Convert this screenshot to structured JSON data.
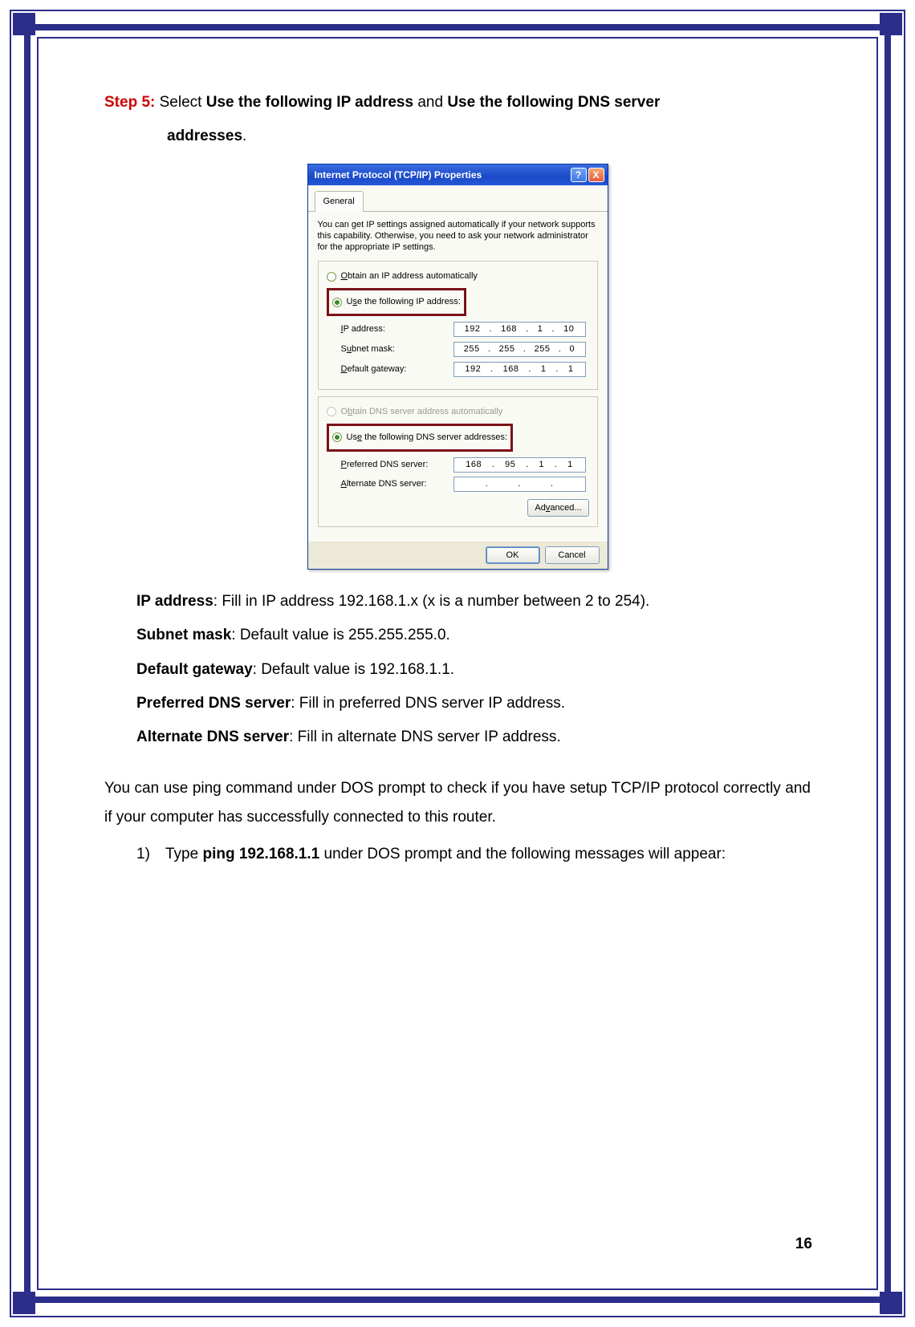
{
  "step": {
    "label": "Step 5:",
    "text1_a": " Select ",
    "text1_b": "Use the following IP address",
    "text1_c": " and ",
    "text1_d": "Use the following DNS server",
    "text2": "addresses",
    "text2_suffix": "."
  },
  "dialog": {
    "title": "Internet Protocol (TCP/IP) Properties",
    "help": "?",
    "close": "X",
    "tab": "General",
    "desc": "You can get IP settings assigned automatically if your network supports this capability. Otherwise, you need to ask your network administrator for the appropriate IP settings.",
    "radio_auto_ip": "Obtain an IP address automatically",
    "radio_use_ip": "Use the following IP address:",
    "lbl_ip": "IP address:",
    "lbl_subnet": "Subnet mask:",
    "lbl_gateway": "Default gateway:",
    "radio_auto_dns": "Obtain DNS server address automatically",
    "radio_use_dns": "Use the following DNS server addresses:",
    "lbl_pref_dns": "Preferred DNS server:",
    "lbl_alt_dns": "Alternate DNS server:",
    "advanced": "Advanced...",
    "ok": "OK",
    "cancel": "Cancel",
    "ip": {
      "a": "192",
      "b": "168",
      "c": "1",
      "d": "10"
    },
    "subnet": {
      "a": "255",
      "b": "255",
      "c": "255",
      "d": "0"
    },
    "gateway": {
      "a": "192",
      "b": "168",
      "c": "1",
      "d": "1"
    },
    "prefdns": {
      "a": "168",
      "b": "95",
      "c": "1",
      "d": "1"
    },
    "altdns": {
      "a": "",
      "b": "",
      "c": "",
      "d": ""
    }
  },
  "list": {
    "ip_b": "IP address",
    "ip_t": ": Fill in IP address 192.168.1.x (x is a number between 2 to 254).",
    "sm_b": "Subnet mask",
    "sm_t": ": Default value is 255.255.255.0.",
    "gw_b": "Default gateway",
    "gw_t": ": Default value is 192.168.1.1.",
    "pd_b": "Preferred DNS server",
    "pd_t": ": Fill in preferred DNS server IP address.",
    "ad_b": "Alternate DNS server",
    "ad_t": ": Fill in alternate DNS server IP address."
  },
  "para": "You can use ping command under DOS prompt to check if you have setup TCP/IP protocol correctly and if your computer has successfully connected to this router.",
  "cmd": {
    "num": "1)",
    "pre": "Type ",
    "bold": "ping 192.168.1.1",
    "post": " under DOS prompt and the following messages will appear:"
  },
  "pagenum": "16"
}
